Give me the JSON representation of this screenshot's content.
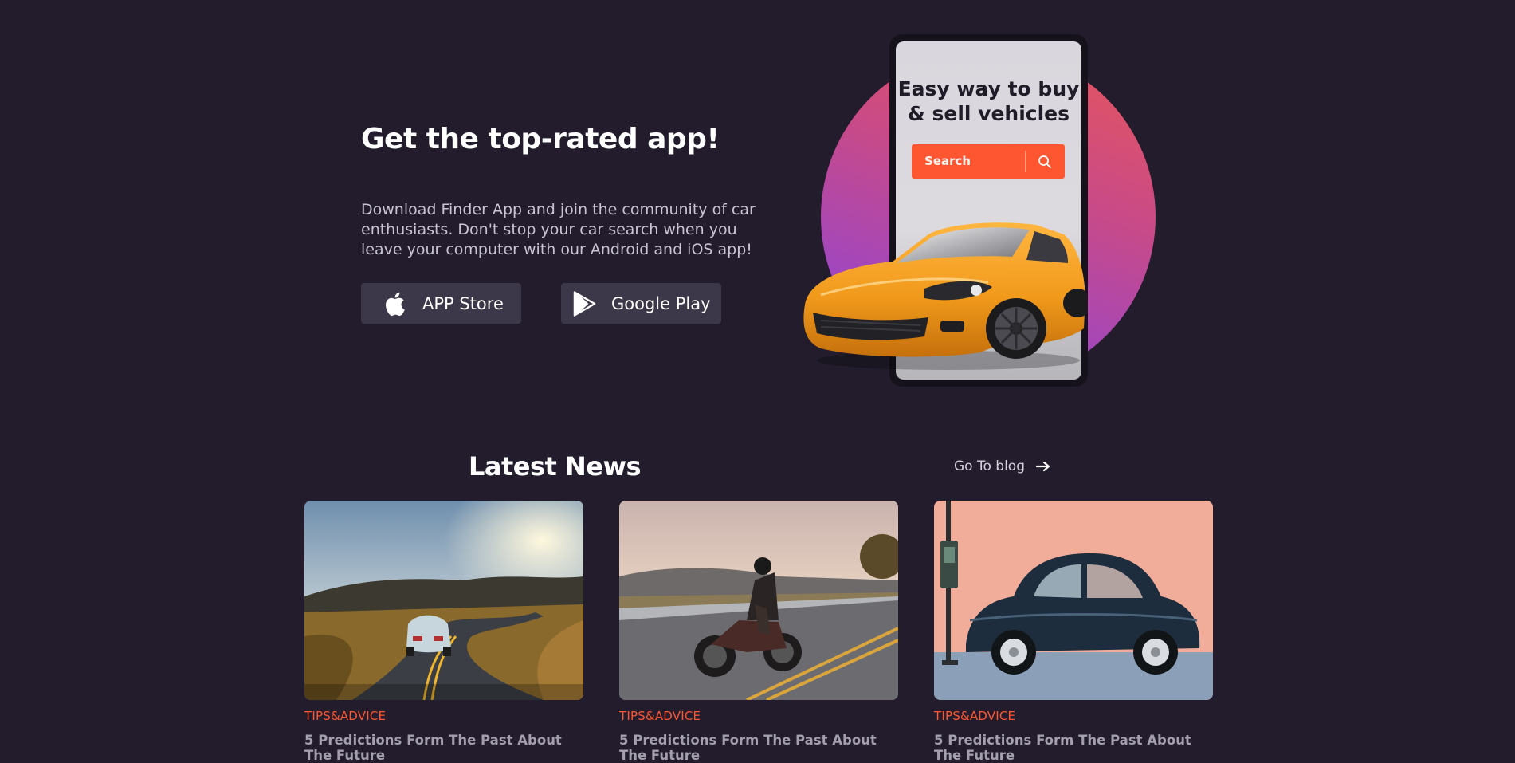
{
  "promo": {
    "title": "Get the top-rated app!",
    "description": "Download Finder App and join the community of car enthusiasts. Don't stop your car search when you leave your computer with our Android and iOS app!",
    "app_store_label": "APP Store",
    "google_play_label": "Google Play",
    "apple_icon": "apple-icon",
    "play_icon": "google-play-icon"
  },
  "phone": {
    "headline": "Easy way to buy & sell vehicles",
    "search_placeholder": "Search",
    "search_icon": "search-icon"
  },
  "news": {
    "title": "Latest News",
    "blog_link": "Go To blog",
    "blog_icon": "arrow-right-icon",
    "cards": [
      {
        "category": "TIPS&ADVICE",
        "title": "5 Predictions Form The Past About The Future"
      },
      {
        "category": "TIPS&ADVICE",
        "title": "5 Predictions Form The Past About The Future"
      },
      {
        "category": "TIPS&ADVICE",
        "title": "5 Predictions Form The Past About The Future"
      }
    ]
  },
  "colors": {
    "background": "#221c2c",
    "button_bg": "#3d3849",
    "accent": "#fd5631",
    "card_title": "#a39fad"
  }
}
